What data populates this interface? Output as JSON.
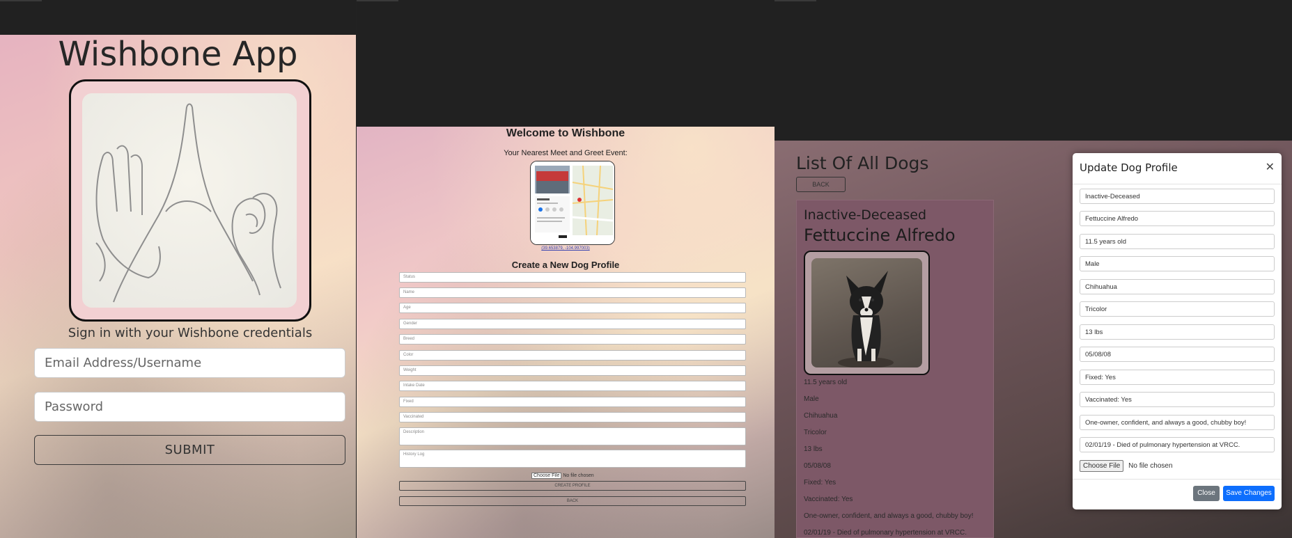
{
  "login": {
    "app_title": "Wishbone App",
    "signin_text": "Sign in with your Wishbone credentials",
    "email_placeholder": "Email Address/Username",
    "password_placeholder": "Password",
    "submit_label": "SUBMIT"
  },
  "create": {
    "welcome": "Welcome to Wishbone",
    "meet_heading": "Your Nearest Meet and Greet Event:",
    "coords": "(39.653879, -104.997003)",
    "form_heading": "Create a New Dog Profile",
    "fields": [
      "Status",
      "Name",
      "Age",
      "Gender",
      "Breed",
      "Color",
      "Weight",
      "Intake Date",
      "Fixed",
      "Vaccinated"
    ],
    "description_placeholder": "Description",
    "history_placeholder": "History Log",
    "choose_file": "Choose File",
    "no_file": "No file chosen",
    "create_button": "CREATE PROFILE",
    "back_button": "BACK"
  },
  "list": {
    "title": "List Of All Dogs",
    "back_button": "BACK",
    "dog": {
      "status": "Inactive-Deceased",
      "name": "Fettuccine Alfredo",
      "details": [
        "11.5 years old",
        "Male",
        "Chihuahua",
        "Tricolor",
        "13 lbs",
        "05/08/08",
        "Fixed: Yes",
        "Vaccinated: Yes",
        "One-owner, confident, and always a good, chubby boy!",
        "02/01/19 - Died of pulmonary hypertension at VRCC."
      ]
    }
  },
  "modal": {
    "title": "Update Dog Profile",
    "fields": [
      "Inactive-Deceased",
      "Fettuccine Alfredo",
      "11.5 years old",
      "Male",
      "Chihuahua",
      "Tricolor",
      "13 lbs",
      "05/08/08",
      "Fixed: Yes",
      "Vaccinated: Yes",
      "One-owner, confident, and always a good, chubby boy!",
      "02/01/19 - Died of pulmonary hypertension at VRCC."
    ],
    "choose_file": "Choose File",
    "no_file": "No file chosen",
    "close_button": "Close",
    "save_button": "Save Changes",
    "close_icon": "close-icon",
    "save_color": "#0d6efd",
    "close_color": "#6c757d"
  }
}
